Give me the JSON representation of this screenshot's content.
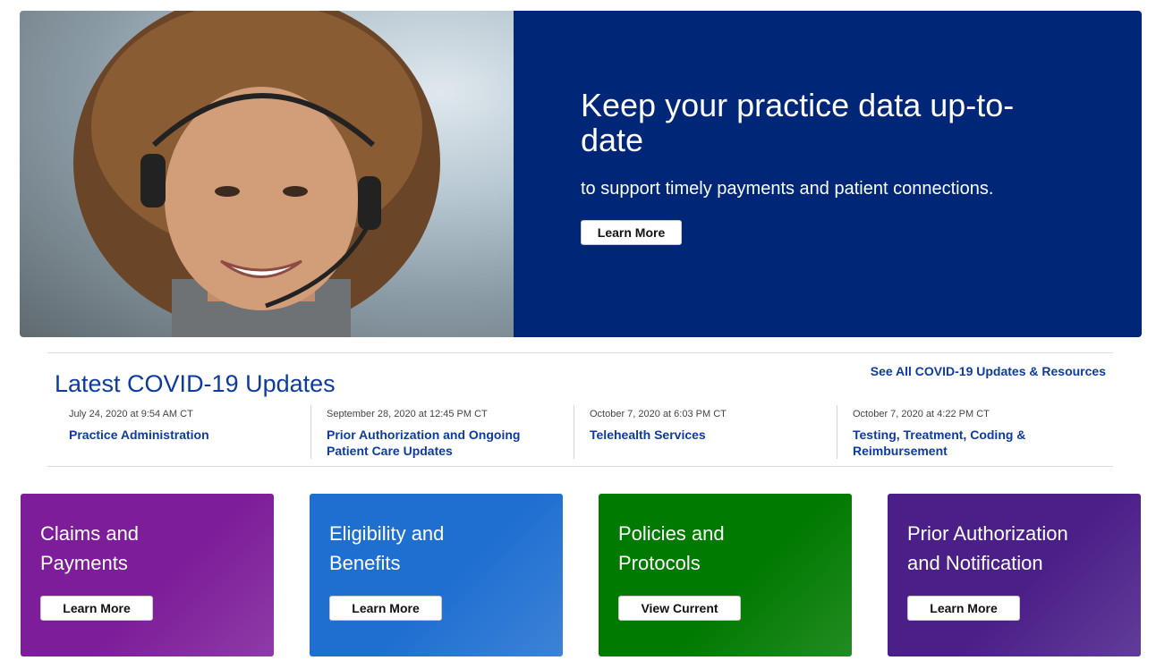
{
  "hero": {
    "title": "Keep your practice data up-to-date",
    "subtitle": "to support timely payments and patient connections.",
    "button_label": "Learn More",
    "panel_color": "#002677"
  },
  "covid": {
    "title": "Latest COVID-19 Updates",
    "see_all_label": "See All COVID-19 Updates & Resources",
    "updates": [
      {
        "date": "July 24, 2020 at 9:54 AM CT",
        "title": "Practice Administration"
      },
      {
        "date": "September 28, 2020 at 12:45 PM CT",
        "title": "Prior Authorization and Ongoing Patient Care Updates"
      },
      {
        "date": "October 7, 2020 at 6:03 PM CT",
        "title": "Telehealth Services"
      },
      {
        "date": "October 7, 2020 at 4:22 PM CT",
        "title": "Testing, Treatment, Coding & Reimbursement"
      }
    ]
  },
  "cards": [
    {
      "title": "Claims and Payments",
      "button_label": "Learn More",
      "color": "#7d1d99"
    },
    {
      "title": "Eligibility and Benefits",
      "button_label": "Learn More",
      "color": "#1f6fd1"
    },
    {
      "title": "Policies and Protocols",
      "button_label": "View Current",
      "color": "#007a00"
    },
    {
      "title": "Prior Authorization and Notification",
      "button_label": "Learn More",
      "color": "#4a1f88"
    }
  ]
}
